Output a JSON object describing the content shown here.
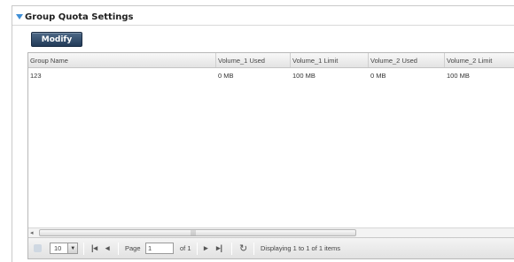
{
  "panel": {
    "title": "Group Quota Settings",
    "modify_label": "Modify"
  },
  "grid": {
    "columns": [
      "Group Name",
      "Volume_1 Used",
      "Volume_1 Limit",
      "Volume_2 Used",
      "Volume_2 Limit"
    ],
    "rows": [
      [
        "123",
        "0 MB",
        "100 MB",
        "0 MB",
        "100 MB"
      ]
    ]
  },
  "pager": {
    "per_page": "10",
    "page_label": "Page",
    "page_value": "1",
    "of_label": "of 1",
    "status": "Displaying 1 to 1 of 1 items"
  },
  "icons": {
    "expand": "triangle-down-icon",
    "first": "first-page-icon",
    "prev": "prev-page-icon",
    "next": "next-page-icon",
    "last": "last-page-icon",
    "refresh": "refresh-icon"
  },
  "colors": {
    "button_top": "#4f6a88",
    "button_bottom": "#213a57",
    "accent": "#3f8fd6"
  }
}
